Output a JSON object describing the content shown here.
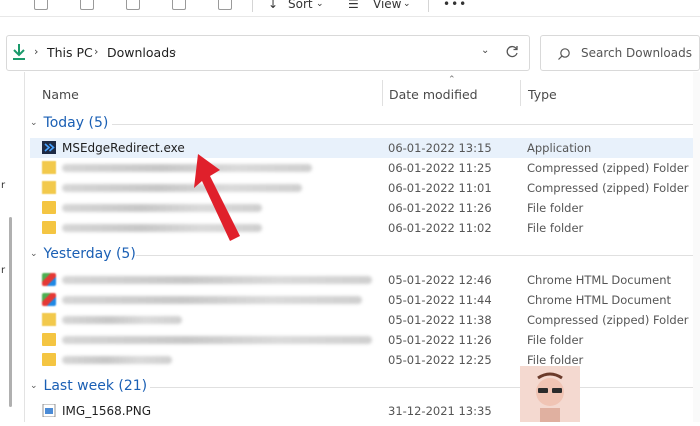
{
  "toolbar": {
    "sort_label": "Sort",
    "view_label": "View",
    "more_label": "•••"
  },
  "address": {
    "crumbs": [
      "This PC",
      "Downloads"
    ]
  },
  "search": {
    "placeholder": "Search Downloads"
  },
  "columns": {
    "name": "Name",
    "date": "Date modified",
    "type": "Type"
  },
  "groups": [
    {
      "label": "Today (5)",
      "rows": [
        {
          "name": "MSEdgeRedirect.exe",
          "date": "06-01-2022 13:15",
          "type": "Application",
          "selected": true
        },
        {
          "name": "",
          "date": "06-01-2022 11:25",
          "type": "Compressed (zipped) Folder"
        },
        {
          "name": "",
          "date": "06-01-2022 11:01",
          "type": "Compressed (zipped) Folder"
        },
        {
          "name": "",
          "date": "06-01-2022 11:26",
          "type": "File folder"
        },
        {
          "name": "",
          "date": "06-01-2022 11:02",
          "type": "File folder"
        }
      ]
    },
    {
      "label": "Yesterday (5)",
      "rows": [
        {
          "name": "",
          "date": "05-01-2022 12:46",
          "type": "Chrome HTML Document"
        },
        {
          "name": "",
          "date": "05-01-2022 11:44",
          "type": "Chrome HTML Document"
        },
        {
          "name": "",
          "date": "05-01-2022 11:38",
          "type": "Compressed (zipped) Folder"
        },
        {
          "name": "",
          "date": "05-01-2022 11:26",
          "type": "File folder"
        },
        {
          "name": "",
          "date": "05-01-2022 12:25",
          "type": "File folder"
        }
      ]
    },
    {
      "label": "Last week (21)",
      "rows": [
        {
          "name": "IMG_1568.PNG",
          "date": "31-12-2021 13:35",
          "type": "PNG File"
        }
      ]
    }
  ],
  "colors": {
    "group_header": "#1a5fb4",
    "selection": "#e8f1fb",
    "arrow": "#e0202b",
    "folder": "#f4c542"
  }
}
